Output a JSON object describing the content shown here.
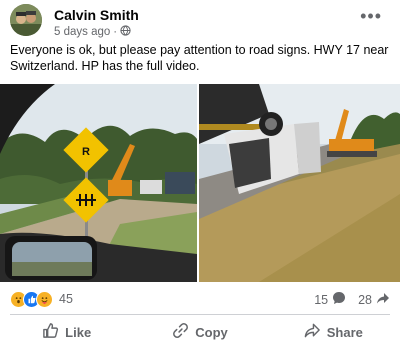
{
  "post": {
    "author": "Calvin Smith",
    "time": "5 days ago",
    "separator": "·",
    "text": "Everyone is ok, but please pay attention to road signs. HWY 17 near Switzerland. HP has the full video."
  },
  "reactions": {
    "count": "45",
    "comments": "15",
    "shares": "28"
  },
  "actions": {
    "like": "Like",
    "copy": "Copy",
    "share": "Share"
  },
  "colors": {
    "text_secondary": "#65676b",
    "like_blue": "#1877f2",
    "love_red": "#f33e58",
    "haha_yellow": "#f7b125"
  }
}
